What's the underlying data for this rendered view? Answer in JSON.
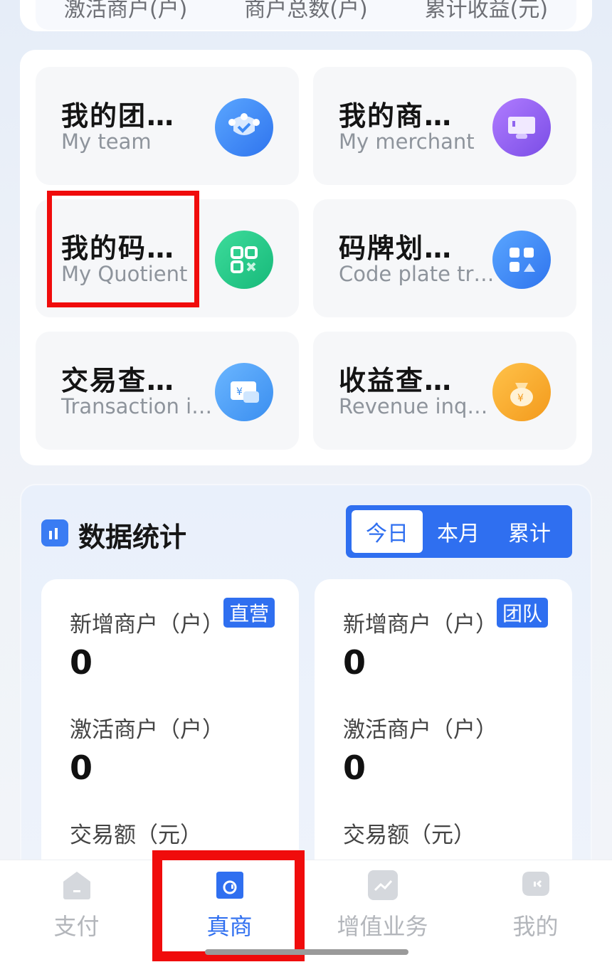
{
  "top_stats": {
    "labels": [
      "激活商户(户)",
      "商户总数(户)",
      "累计收益(元)"
    ]
  },
  "menu": {
    "items": [
      {
        "title": "我的团…",
        "subtitle": "My team",
        "icon": "team-icon",
        "color": "#3f8cf7"
      },
      {
        "title": "我的商…",
        "subtitle": "My merchant",
        "icon": "merchant-icon",
        "color": "#8f63f0"
      },
      {
        "title": "我的码…",
        "subtitle": "My Quotient",
        "icon": "qr-code-icon",
        "color": "#1fc98a"
      },
      {
        "title": "码牌划…",
        "subtitle": "Code plate tr…",
        "icon": "code-plate-icon",
        "color": "#3f8cf7"
      },
      {
        "title": "交易查…",
        "subtitle": "Transaction i…",
        "icon": "transaction-icon",
        "color": "#4a9cf6"
      },
      {
        "title": "收益查…",
        "subtitle": "Revenue inq…",
        "icon": "revenue-bag-icon",
        "color": "#f7a52c"
      }
    ]
  },
  "stats": {
    "title": "数据统计",
    "tabs": [
      "今日",
      "本月",
      "累计"
    ],
    "active_tab": "今日",
    "direct": {
      "tag": "直营",
      "new_label": "新增商户（户）",
      "new_value": "0",
      "active_label": "激活商户（户）",
      "active_value": "0",
      "amount_label": "交易额（元）"
    },
    "team": {
      "tag": "团队",
      "new_label": "新增商户（户）",
      "new_value": "0",
      "active_label": "激活商户（户）",
      "active_value": "0",
      "amount_label": "交易额（元）"
    }
  },
  "nav": {
    "items": [
      {
        "label": "支付",
        "icon": "home-icon"
      },
      {
        "label": "真商",
        "icon": "merchant-tab-icon"
      },
      {
        "label": "增值业务",
        "icon": "chart-icon"
      },
      {
        "label": "我的",
        "icon": "profile-icon"
      }
    ],
    "active": "真商"
  },
  "colors": {
    "accent": "#2f6ff0",
    "highlight": "#f00c0c"
  }
}
